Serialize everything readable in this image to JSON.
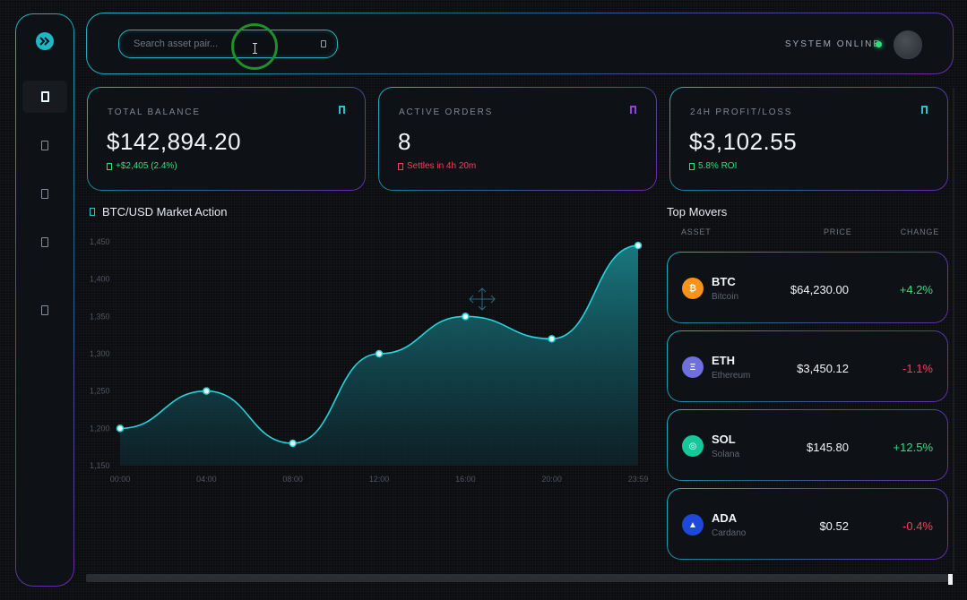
{
  "header": {
    "search_placeholder": "Search asset pair...",
    "status": "SYSTEM ONLINE"
  },
  "sidebar": {
    "items": [
      "dashboard-icon",
      "wallet-icon",
      "orders-icon",
      "analytics-icon",
      "settings-icon"
    ]
  },
  "cards": [
    {
      "label": "TOTAL BALANCE",
      "value": "$142,894.20",
      "sub": "+$2,405 (2.4%)",
      "sub_color": "#2ee07e",
      "icon_color": "#27c5d0"
    },
    {
      "label": "ACTIVE ORDERS",
      "value": "8",
      "sub": "Settles in 4h 20m",
      "sub_color": "#ff3b5c",
      "icon_color": "#9a3fd6"
    },
    {
      "label": "24H PROFIT/LOSS",
      "value": "$3,102.55",
      "sub": "5.8% ROI",
      "sub_color": "#2ee07e",
      "icon_color": "#27c5d0"
    }
  ],
  "chart_title": "BTC/USD Market Action",
  "chart_data": {
    "type": "area",
    "x": [
      "00:00",
      "04:00",
      "08:00",
      "12:00",
      "16:00",
      "20:00",
      "23:59"
    ],
    "values": [
      1200,
      1250,
      1180,
      1300,
      1350,
      1320,
      1445
    ],
    "yticks": [
      "1,450",
      "1,400",
      "1,350",
      "1,300",
      "1,250",
      "1,200",
      "1,150"
    ],
    "ylim": [
      1150,
      1450
    ],
    "grid": false,
    "line_color": "#27d3dc"
  },
  "movers": {
    "title": "Top Movers",
    "columns": {
      "asset": "ASSET",
      "price": "PRICE",
      "change": "CHANGE"
    },
    "rows": [
      {
        "symbol": "BTC",
        "name": "Bitcoin",
        "price": "$64,230.00",
        "change": "+4.2%",
        "up": true,
        "coin_color": "#f7931a",
        "glyph": "₿"
      },
      {
        "symbol": "ETH",
        "name": "Ethereum",
        "price": "$3,450.12",
        "change": "-1.1%",
        "up": false,
        "coin_color": "#6f6fe0",
        "glyph": "Ξ"
      },
      {
        "symbol": "SOL",
        "name": "Solana",
        "price": "$145.80",
        "change": "+12.5%",
        "up": true,
        "coin_color": "#16c79a",
        "glyph": "◎"
      },
      {
        "symbol": "ADA",
        "name": "Cardano",
        "price": "$0.52",
        "change": "-0.4%",
        "up": false,
        "coin_color": "#1e48d8",
        "glyph": "▲"
      }
    ]
  }
}
